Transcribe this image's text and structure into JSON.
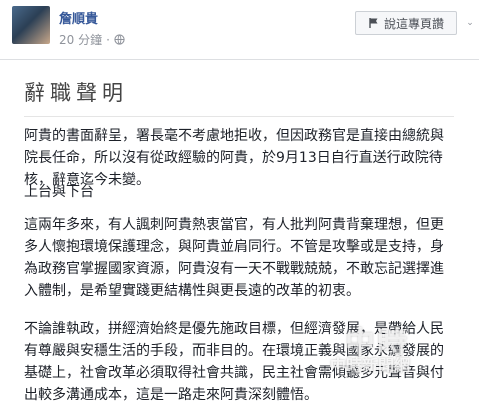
{
  "post": {
    "author": "詹順貴",
    "time": "20 分鐘",
    "follow_label": "說這專頁讚",
    "more": "⌄"
  },
  "note": {
    "title": "辭職聲明",
    "paragraphs": [
      "阿貴的書面辭呈，署長毫不考慮地拒收，但因政務官是直接由總統與院長任命，所以沒有從政經驗的阿貴，於9月13日自行直送行政院待核，辭意迄今未變。",
      "上台與下台",
      "這兩年多來，有人諷刺阿貴熱衷當官，有人批判阿貴背棄理想，但更多人懷抱環境保護理念，與阿貴並肩同行。不管是攻擊或是支持，身為政務官掌握國家資源，阿貴沒有一天不戰戰兢兢，不敢忘記選擇進入體制，是希望實踐更結構性與更長遠的改革的初衷。",
      "不論誰執政，拼經濟始終是優先施政目標，但經濟發展，是帶給人民有尊嚴與安穩生活的手段，而非目的。在環境正義與國家永續發展的基礎上，社會改革必須取得社會共識，民主社會需傾聽多元聲音與付出較多溝通成本，這是一路走來阿貴深刻體悟。"
    ]
  },
  "watermark": {
    "line1": "中時",
    "line2": "中時新聞網"
  },
  "colors": {
    "author": "#365899",
    "meta": "#90949c",
    "text": "#1d2129"
  },
  "icons": {
    "globe": "globe-icon",
    "flag": "flag-icon"
  }
}
